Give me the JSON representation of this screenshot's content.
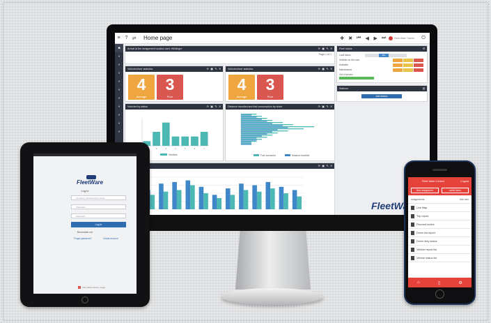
{
  "screen": {
    "page_title": "Home page",
    "user": "Fleet Ware Trainer",
    "alerts_title": "Arrival at the assignment location alert: Wilklinger",
    "alerts_count": "Page 1 of 1",
    "kpi_panel_1": "Vehicle/driver statistics",
    "kpi_panel_2": "Vehicle/driver statistics",
    "kpis": [
      {
        "value": "4",
        "label": "Average"
      },
      {
        "value": "3",
        "label": "Poor"
      },
      {
        "value": "4",
        "label": "Average"
      },
      {
        "value": "3",
        "label": "Poor"
      }
    ],
    "fleet_status": "Fleet status",
    "fleet_rows": [
      "Load status",
      "Vehicles on the road",
      "Available",
      "Maintenance",
      "Out of service"
    ],
    "load_badge": "Idle",
    "stations": "Stations",
    "stations_button": "Add station",
    "chart1_title": "Vehicles by status",
    "chart1_legend": "Vehicles",
    "chart2_title": "Distance travelled and fuel consumption by driver",
    "chart2_legend": [
      "Fuel consumed",
      "Distance travelled"
    ],
    "chart3_title": "Trips by hour",
    "brand": "FleetWare",
    "menu_icons": [
      "menu-icon",
      "help-icon",
      "share-icon"
    ]
  },
  "ipad": {
    "brand": "FleetWare",
    "login_title": "Log in",
    "fields": [
      "Company name/Account name",
      "Username",
      "Password"
    ],
    "button": "Log in",
    "remember": "Remember me",
    "links": [
      "Forgot password?",
      "Create account"
    ],
    "footer": "Fleet Ware Secure Login"
  },
  "iphone": {
    "header": "Fleet Ware Control",
    "header_right": "Logout",
    "tabs": [
      "New assignment",
      "Latest items"
    ],
    "sub_left": "Assignments",
    "sub_right": "Add new",
    "items": [
      "Live Map",
      "Trip report",
      "Planned routes",
      "Driver list report",
      "Driver duty status",
      "Vehicle report list",
      "Vehicle status list"
    ]
  },
  "colors": {
    "accent_red": "#e5423b",
    "accent_blue": "#2e6db0",
    "chart_teal": "#4bb8b3",
    "chart_blue": "#3f87c8"
  },
  "chart_data": [
    {
      "type": "bar",
      "title": "Vehicles by status",
      "legend": [
        "Vehicles"
      ],
      "categories": [
        "1",
        "2",
        "3",
        "4",
        "5",
        "6",
        "7"
      ],
      "values": [
        1,
        3,
        5,
        2,
        2,
        2,
        3
      ]
    },
    {
      "type": "bar",
      "orientation": "horizontal",
      "title": "Distance travelled and fuel consumption by driver",
      "series": [
        {
          "name": "Fuel consumed",
          "values": [
            3,
            4,
            5,
            6,
            8,
            10,
            14,
            12,
            9,
            7,
            6,
            5,
            4,
            3,
            2
          ]
        },
        {
          "name": "Distance travelled",
          "values": [
            2,
            3,
            4,
            5,
            6,
            8,
            9,
            7,
            6,
            5,
            4,
            3,
            3,
            2,
            2
          ]
        }
      ]
    },
    {
      "type": "bar",
      "title": "Trips by hour",
      "series": [
        {
          "name": "A",
          "values": [
            12,
            16,
            17,
            18,
            14,
            9,
            13,
            16,
            15,
            17,
            14,
            12
          ]
        },
        {
          "name": "B",
          "values": [
            9,
            11,
            12,
            15,
            10,
            7,
            9,
            12,
            11,
            13,
            10,
            8
          ]
        }
      ]
    }
  ]
}
